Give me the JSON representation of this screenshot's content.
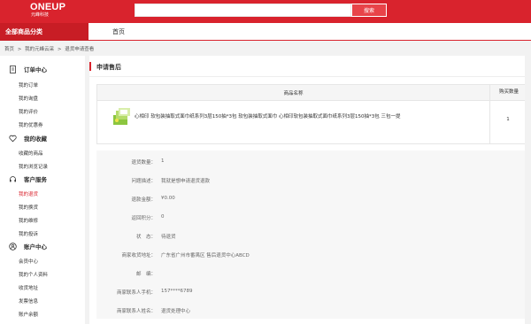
{
  "header": {
    "logo_main": "ONEUP",
    "logo_sub": "元峰科技",
    "search_placeholder": "",
    "search_button": "搜索"
  },
  "nav": {
    "category": "全部商品分类",
    "home": "首页"
  },
  "breadcrumb": [
    "首页",
    ">",
    "我的元峰云采",
    ">",
    "退货申请查看"
  ],
  "sidebar": {
    "sections": [
      {
        "title": "订单中心",
        "icon": "document-icon",
        "items": [
          {
            "label": "我的订单"
          },
          {
            "label": "我的询盘"
          },
          {
            "label": "我的评价"
          },
          {
            "label": "我的优惠券"
          }
        ]
      },
      {
        "title": "我的收藏",
        "icon": "heart-icon",
        "items": [
          {
            "label": "收藏的商品"
          },
          {
            "label": "我的浏览记录"
          }
        ]
      },
      {
        "title": "客户服务",
        "icon": "headset-icon",
        "items": [
          {
            "label": "我的退货",
            "active": true
          },
          {
            "label": "我的换货"
          },
          {
            "label": "我的维修"
          },
          {
            "label": "我的投诉"
          }
        ]
      },
      {
        "title": "账户中心",
        "icon": "user-icon",
        "items": [
          {
            "label": "会员中心"
          },
          {
            "label": "我的个人资料"
          },
          {
            "label": "收货地址"
          },
          {
            "label": "发票信息"
          },
          {
            "label": "账户余额"
          }
        ]
      }
    ]
  },
  "main": {
    "title": "申请售后",
    "table": {
      "col_name": "商品名称",
      "col_qty": "购买数量",
      "product_name": "心相印 软包装抽取式面巾纸系列3层150抽*3包 软包装抽取式面巾 心相印软包装抽取式面巾纸系列3层150抽*3包 三包一提",
      "qty": "1"
    },
    "details": [
      {
        "label": "退货数量：",
        "value": "1"
      },
      {
        "label": "问题描述：",
        "value": "我就是想申请退货退款"
      },
      {
        "label": "退款金额：",
        "value": "¥0.00"
      },
      {
        "label": "返回积分：",
        "value": "0"
      },
      {
        "label": "状　态：",
        "value": "待退货"
      },
      {
        "label": "商家收货地址：",
        "value": "广东省广州市番禺区 售后退货中心ABCD"
      },
      {
        "label": "邮　编：",
        "value": ""
      },
      {
        "label": "商家联系人手机：",
        "value": "157****6789"
      },
      {
        "label": "商家联系人姓名：",
        "value": "退货处理中心"
      }
    ]
  },
  "colors": {
    "brand_red": "#d9232d",
    "category_red": "#c81d25",
    "button_red": "#e84349"
  }
}
